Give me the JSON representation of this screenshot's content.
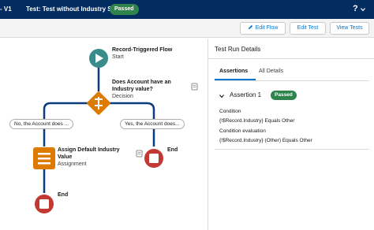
{
  "header": {
    "crumb": "- V1",
    "title": "Test: Test without Industry Set",
    "status_badge": "Passed",
    "help_label": "?"
  },
  "toolbar": {
    "edit_flow": "Edit Flow",
    "edit_test": "Edit Test",
    "view_tests": "View Tests"
  },
  "flow": {
    "start": {
      "title": "Record-Triggered Flow",
      "type": "Start"
    },
    "decision": {
      "title_line1": "Does Account have an",
      "title_line2": "Industry value?",
      "type": "Decision"
    },
    "branch_left": "No, the Account does ...",
    "branch_right": "Yes, the Account does...",
    "assignment": {
      "title_line1": "Assign Default Industry",
      "title_line2": "Value",
      "type": "Assignment"
    },
    "end_right": "End",
    "end_bottom": "End"
  },
  "panel": {
    "title": "Test Run Details",
    "tabs": [
      "Assertions",
      "All Details"
    ],
    "assertion": {
      "title": "Assertion 1",
      "badge": "Passed",
      "condition_label": "Condition",
      "condition_value": "{!$Record.Industry} Equals Other",
      "evaluation_label": "Condition evaluation",
      "evaluation_value": "{!$Record.Industry} (Other) Equals Other"
    }
  },
  "colors": {
    "header_bg": "#032d60",
    "passed_green": "#2e844a",
    "flow_line": "#0b3d7a",
    "start_node": "#3a8b8b",
    "decision_node": "#dd7a01",
    "assignment_node": "#dd7a01",
    "end_node": "#c23934",
    "link_blue": "#0176d3"
  },
  "icons": {
    "edit_flow": "pencil-icon",
    "help_dropdown": "chevron-down-icon",
    "assertion_toggle": "chevron-down-icon",
    "start": "play-icon",
    "decision": "decision-icon",
    "assignment": "assignment-icon",
    "end": "stop-icon",
    "note": "note-icon"
  }
}
